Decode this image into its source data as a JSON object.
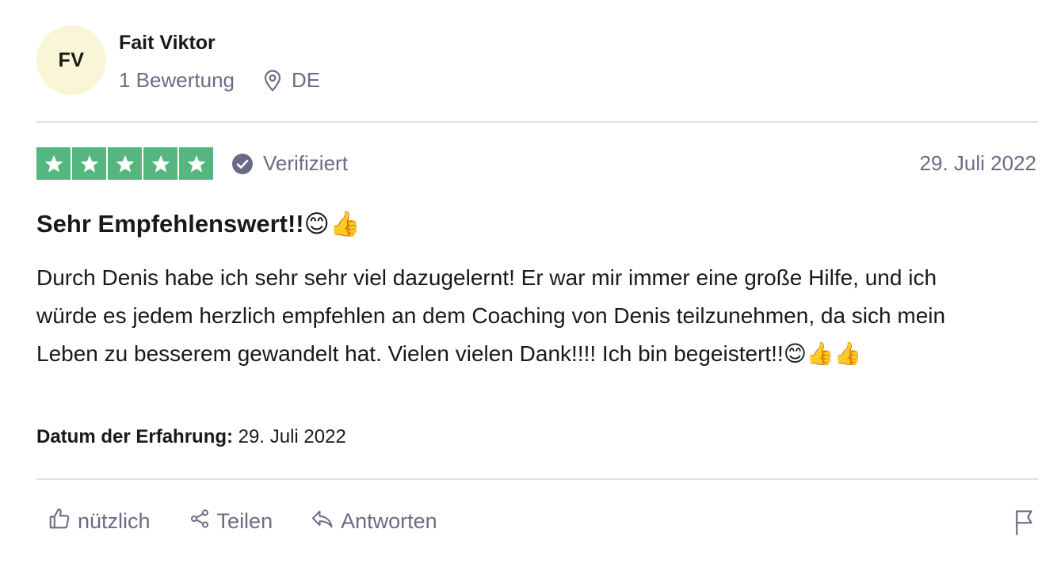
{
  "reviewer": {
    "initials": "FV",
    "name": "Fait Viktor",
    "review_count": "1 Bewertung",
    "country": "DE"
  },
  "rating": {
    "stars": 5,
    "star_icon": "star-icon",
    "verified_label": "Verifiziert",
    "date": "29. Juli 2022"
  },
  "review": {
    "title": "Sehr Empfehlenswert!!😊👍",
    "body": "Durch Denis habe ich sehr sehr viel dazugelernt! Er war mir immer eine große Hilfe, und ich würde es jedem herzlich empfehlen an dem Coaching von Denis teilzunehmen, da sich mein Leben zu besserem gewandelt hat. Vielen vielen Dank!!!! Ich bin begeistert!!😊👍👍",
    "experience_label": "Datum der Erfahrung:",
    "experience_date": " 29. Juli 2022"
  },
  "actions": {
    "helpful_label": "nützlich",
    "share_label": "Teilen",
    "reply_label": "Antworten"
  },
  "colors": {
    "star_green": "#55b780",
    "avatar_bg": "#f9f5d7",
    "muted_text": "#6b6b85",
    "divider": "#e0e0e6"
  }
}
